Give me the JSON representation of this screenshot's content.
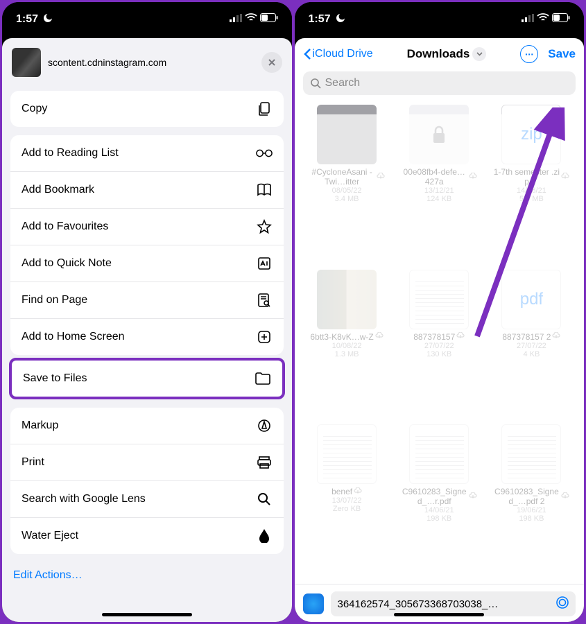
{
  "statusbar": {
    "time": "1:57"
  },
  "left": {
    "url": "scontent.cdninstagram.com",
    "group1": [
      {
        "label": "Copy",
        "icon": "copy-icon",
        "name": "copy-action"
      }
    ],
    "group2": [
      {
        "label": "Add to Reading List",
        "icon": "glasses-icon",
        "name": "reading-list-action"
      },
      {
        "label": "Add Bookmark",
        "icon": "book-icon",
        "name": "bookmark-action"
      },
      {
        "label": "Add to Favourites",
        "icon": "star-icon",
        "name": "favourites-action"
      },
      {
        "label": "Add to Quick Note",
        "icon": "quicknote-icon",
        "name": "quick-note-action"
      },
      {
        "label": "Find on Page",
        "icon": "findpage-icon",
        "name": "find-on-page-action"
      },
      {
        "label": "Add to Home Screen",
        "icon": "addsquare-icon",
        "name": "home-screen-action"
      }
    ],
    "highlighted": {
      "label": "Save to Files",
      "icon": "folder-icon",
      "name": "save-to-files-action"
    },
    "group3": [
      {
        "label": "Markup",
        "icon": "markup-icon",
        "name": "markup-action"
      },
      {
        "label": "Print",
        "icon": "printer-icon",
        "name": "print-action"
      },
      {
        "label": "Search with Google Lens",
        "icon": "search-icon",
        "name": "google-lens-action"
      },
      {
        "label": "Water Eject",
        "icon": "drop-icon",
        "name": "water-eject-action"
      }
    ],
    "edit": "Edit Actions…"
  },
  "right": {
    "back": "iCloud Drive",
    "title": "Downloads",
    "save": "Save",
    "search_placeholder": "Search",
    "files": [
      {
        "name": "#CycloneAsani - Twi…itter",
        "date": "08/05/22",
        "size": "3.4 MB",
        "thumb": "thumb-gray",
        "cloud": true
      },
      {
        "name": "00e08fb4-defe…427a",
        "date": "13/12/21",
        "size": "124 KB",
        "thumb": "thumb-lock",
        "cloud": true,
        "lock": true
      },
      {
        "name": "1-7th semester .zip",
        "date": "14/06/21",
        "size": "5.5 MB",
        "thumb": "thumb-white",
        "cloud": true,
        "overlay": "zip"
      },
      {
        "name": "6btt3-K8vK…w-Z",
        "date": "10/08/22",
        "size": "1.3 MB",
        "thumb": "img-thumb",
        "cloud": true
      },
      {
        "name": "887378157",
        "date": "27/07/22",
        "size": "130 KB",
        "thumb": "doc-thumb",
        "cloud": true
      },
      {
        "name": "887378157 2",
        "date": "27/07/22",
        "size": "4 KB",
        "thumb": "thumb-white",
        "cloud": true,
        "overlay": "pdf"
      },
      {
        "name": "benef",
        "date": "13/07/22",
        "size": "Zero KB",
        "thumb": "doc-thumb",
        "cloud": true
      },
      {
        "name": "C9610283_Signed_…r.pdf",
        "date": "14/06/21",
        "size": "198 KB",
        "thumb": "doc-thumb",
        "cloud": true
      },
      {
        "name": "C9610283_Signed_…pdf 2",
        "date": "19/06/21",
        "size": "198 KB",
        "thumb": "doc-thumb",
        "cloud": true
      }
    ],
    "filename": "364162574_305673368703038_…"
  }
}
